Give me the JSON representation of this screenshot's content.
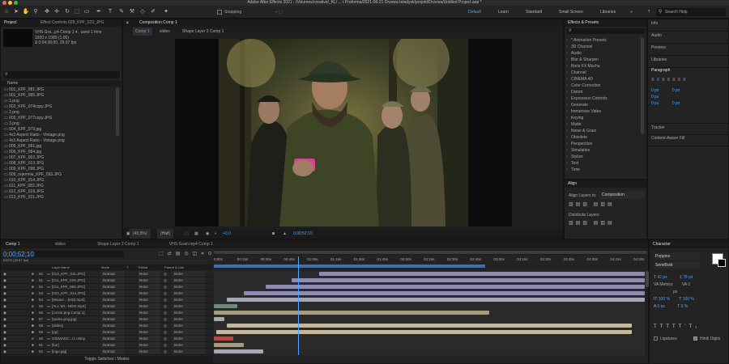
{
  "window": {
    "title": "Adobe After Effects 2021 - /Volumes/creative/_KL/ ... t Proforma/2021-06-21 Drzewa teledysk/projekt/Drzewa/Untitled Project.aep *"
  },
  "toolbar": {
    "snapping": "Snapping",
    "workspaces": [
      "Default",
      "Learn",
      "Standard",
      "Small Screen",
      "Libraries"
    ],
    "search_placeholder": "Search Help"
  },
  "project": {
    "tab": "Project",
    "effect_tab": "Effect Controls 028_KPF_023_JPG",
    "item_name": "VHS Gra...p4 Comp 1 ▾ , used 1 time",
    "item_res": "1920 x 1080 (1.00)",
    "item_dur": "Δ 0;04;30;00, 29.97 fps",
    "col_name": "Name",
    "files": [
      "001_KPF_081.JPG",
      "001_KPF_085.JPG",
      "1.png",
      "002_KPF_074copy.JPG",
      "2.png",
      "003_KPF_077copy.JPG",
      "3.png",
      "004_KPF_079.jpg",
      "4x3 Aspect Ratio - Vintage.png",
      "4x3 Aspect Ratio - Vintage.png",
      "005_KPF_081.jpg",
      "006_KPF_084.jpg",
      "007_KPF_002.JPG",
      "008_KPF_013.JPG",
      "009_KPF_098.JPG",
      "009_rejemnie_KPF_093.JPG",
      "010_KPF_014.JPG",
      "011_KPF_082.JPG",
      "012_KPF_018.JPG",
      "013_KPF_011.JPG"
    ]
  },
  "composition": {
    "tab": "Composition Comp 1",
    "subtabs": [
      "Comp 1",
      "slides",
      "Shape Layer 2 Comp 1"
    ],
    "zoom": "(45,5%)",
    "quality": "(Half)",
    "exposure": "+0,0",
    "timecode": "0;00;52;10"
  },
  "effects": {
    "title": "Effects & Presets",
    "search_placeholder": "",
    "items": [
      "* Animation Presets",
      "3D Channel",
      "Audio",
      "Blur & Sharpen",
      "Boris FX Mocha",
      "Channel",
      "CINEMA 4D",
      "Color Correction",
      "Distort",
      "Expression Controls",
      "Generate",
      "Immersive Video",
      "Keying",
      "Matte",
      "Noise & Grain",
      "Obsolete",
      "Perspective",
      "Simulation",
      "Stylize",
      "Text",
      "Time"
    ]
  },
  "align": {
    "title": "Align",
    "align_to_label": "Align Layers to:",
    "align_to_value": "Composition",
    "distribute": "Distribute Layers:"
  },
  "side": {
    "items": [
      "Info",
      "Audio",
      "Preview",
      "Libraries"
    ],
    "paragraph": "Paragraph",
    "values": [
      "0 px",
      "0 px",
      "0 px",
      "0 px",
      "0 px"
    ],
    "tracker": "Tracker",
    "content_fill": "Content-Aware Fill"
  },
  "timeline": {
    "tabs": [
      "Comp 1",
      "slides",
      "Shape Layer 2 Comp 1",
      "VHS Grain.mp4 Comp 1"
    ],
    "timecode": "0;00;52;10",
    "fps_sub": "01570 (29.97 fps)",
    "columns": {
      "name": "Layer Name",
      "mode": "Mode",
      "t": "T",
      "trkmat": "TrkMat",
      "parent": "Parent & Link"
    },
    "ruler": [
      "0:00s",
      "00:15s",
      "00:30s",
      "00:45s",
      "01:00s",
      "01:15s",
      "01:30s",
      "01:45s",
      "02:00s",
      "02:15s",
      "02:30s",
      "02:45s",
      "03:00s",
      "03:15s",
      "03:30s",
      "03:45s",
      "04:00s",
      "04:15s",
      "04:30s"
    ],
    "toggle_label": "Toggle Switches / Modes",
    "layers": [
      {
        "num": "50",
        "name": "[013_KPF_011.JPG]",
        "mode": "Normal",
        "trk": "None",
        "parent": "None",
        "color": "#8f8bb1",
        "start": 0.245,
        "end": 1.0
      },
      {
        "num": "51",
        "name": "[011_KPF_018.JPG]",
        "mode": "Normal",
        "trk": "None",
        "parent": "None",
        "color": "#8f8bb1",
        "start": 0.18,
        "end": 1.0
      },
      {
        "num": "52",
        "name": "[011_KPF_083.JPG]",
        "mode": "Normal",
        "trk": "None",
        "parent": "None",
        "color": "#8f8bb1",
        "start": 0.12,
        "end": 1.0
      },
      {
        "num": "53",
        "name": "[010_KPF_014.JPG]",
        "mode": "Normal",
        "trk": "None",
        "parent": "None",
        "color": "#8f8bb1",
        "start": 0.07,
        "end": 1.0
      },
      {
        "num": "54",
        "name": "[Mouse ...(HD).mp4]",
        "mode": "Normal",
        "trk": "None",
        "parent": "None",
        "color": "#a7a6b3",
        "start": 0.03,
        "end": 1.0
      },
      {
        "num": "55",
        "name": "[ALL WI...NDS!.mp4]",
        "mode": "Normal",
        "trk": "None",
        "parent": "None",
        "color": "#6f8a78",
        "start": 0.0,
        "end": 0.055
      },
      {
        "num": "56",
        "name": "[cursor.png Comp 1]",
        "mode": "Normal",
        "trk": "None",
        "parent": "None",
        "color": "#a79c82",
        "start": 0.0,
        "end": 0.64
      },
      {
        "num": "57",
        "name": "[spoko.png.jpg]",
        "mode": "Normal",
        "trk": "None",
        "parent": "None",
        "color": "#a7a6b3",
        "start": 0.0,
        "end": 0.025
      },
      {
        "num": "58",
        "name": "[slides]",
        "mode": "Normal",
        "trk": "None",
        "parent": "None",
        "color": "#c2b79c",
        "start": 0.03,
        "end": 0.97
      },
      {
        "num": "59",
        "name": "[pp]",
        "mode": "Normal",
        "trk": "None",
        "parent": "None",
        "color": "#c2b79c",
        "start": 0.005,
        "end": 0.97
      },
      {
        "num": "60",
        "name": "OŚWIADC...rz ustny.",
        "mode": "Normal",
        "trk": "None",
        "parent": "None",
        "color": "#b14a4a",
        "start": 0.0,
        "end": 0.045
      },
      {
        "num": "61",
        "name": "[kar]",
        "mode": "Normal",
        "trk": "None",
        "parent": "None",
        "color": "#a79c82",
        "start": 0.0,
        "end": 0.07
      },
      {
        "num": "62",
        "name": "[logo.jpg]",
        "mode": "Normal",
        "trk": "None",
        "parent": "None",
        "color": "#a7a6b3",
        "start": 0.0,
        "end": 0.115
      }
    ],
    "playhead": 0.195,
    "work_area_end": 0.63
  },
  "character": {
    "title": "Character",
    "font": "Poppins",
    "style": "SemiBold",
    "size": "42 px",
    "leading": "78 px",
    "kerning": "Metrics",
    "tracking": "0",
    "unit": "px",
    "vscale": "100 %",
    "hscale": "100 %",
    "baseline": "0 px",
    "tsume": "0 %",
    "ligatures": "Ligatures",
    "hindi": "Hindi Digits"
  }
}
